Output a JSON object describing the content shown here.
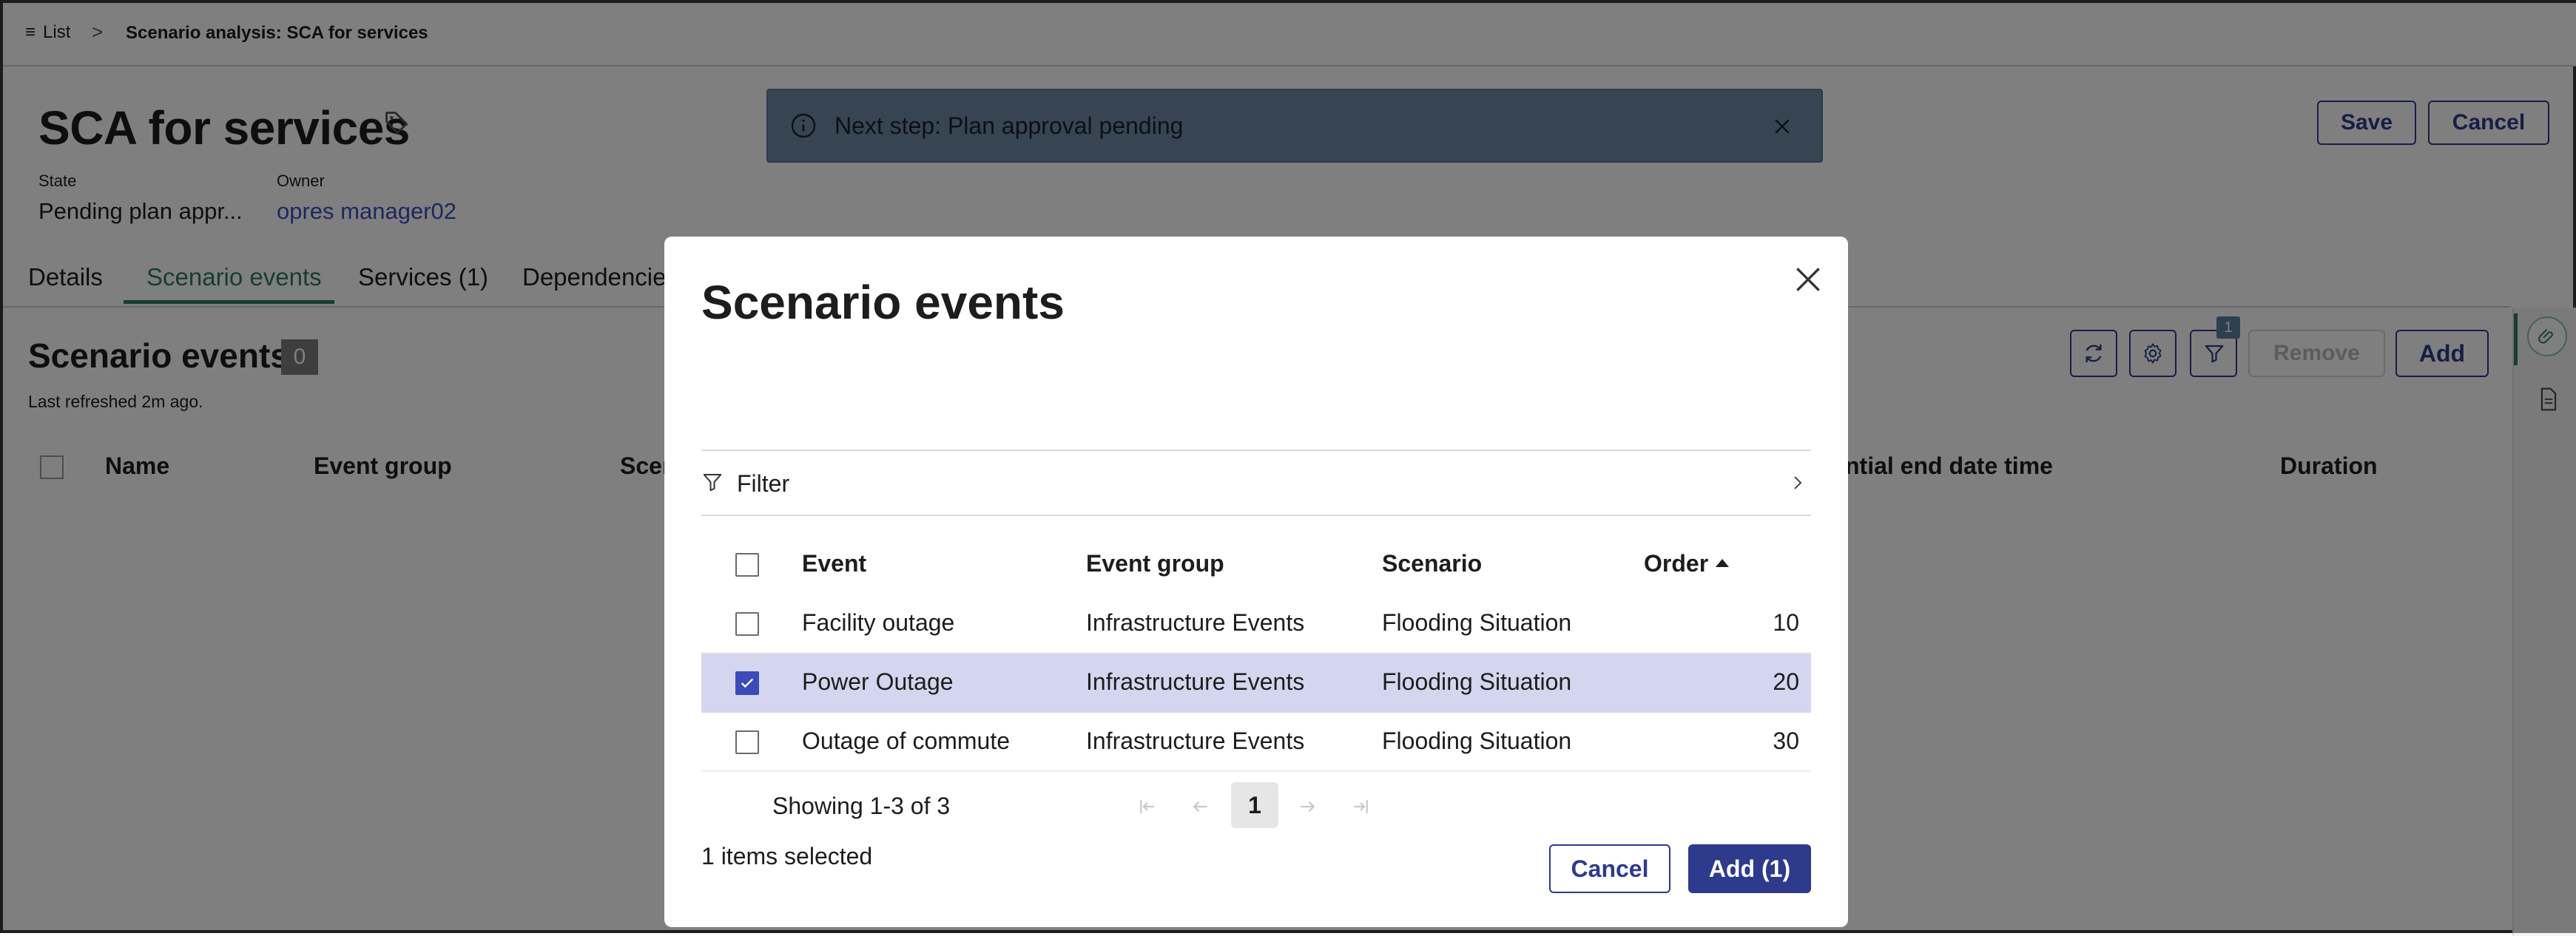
{
  "breadcrumb": {
    "list_icon": "list-icon",
    "list_label": "List",
    "separator": ">",
    "current": "Scenario analysis: SCA for services"
  },
  "header": {
    "title": "SCA for services",
    "tag_icon": "tag-icon",
    "state_label": "State",
    "state_value": "Pending plan appr...",
    "owner_label": "Owner",
    "owner_value": "opres manager02",
    "save_label": "Save",
    "cancel_label": "Cancel"
  },
  "toast": {
    "icon": "info-icon",
    "message": "Next step: Plan approval pending"
  },
  "tabs": [
    {
      "label": "Details"
    },
    {
      "label": "Scenario events",
      "active": true
    },
    {
      "label": "Services (1)"
    },
    {
      "label": "Dependencies"
    }
  ],
  "list": {
    "title": "Scenario events",
    "count": "0",
    "last_refreshed": "Last refreshed 2m ago.",
    "filter_badge": "1",
    "remove_label": "Remove",
    "add_label": "Add",
    "columns": [
      "Name",
      "Event group",
      "Scen",
      "ntial end date time",
      "Duration"
    ]
  },
  "modal": {
    "title": "Scenario events",
    "filter_label": "Filter",
    "columns": {
      "event": "Event",
      "event_group": "Event group",
      "scenario": "Scenario",
      "order": "Order"
    },
    "rows": [
      {
        "event": "Facility outage",
        "event_group": "Infrastructure Events",
        "scenario": "Flooding Situation",
        "order": "10",
        "checked": false
      },
      {
        "event": "Power Outage",
        "event_group": "Infrastructure Events",
        "scenario": "Flooding Situation",
        "order": "20",
        "checked": true
      },
      {
        "event": "Outage of commute",
        "event_group": "Infrastructure Events",
        "scenario": "Flooding Situation",
        "order": "30",
        "checked": false
      }
    ],
    "showing": "Showing 1-3 of 3",
    "page": "1",
    "selected_count": "1 items selected",
    "cancel_label": "Cancel",
    "add_label": "Add (1)"
  },
  "colors": {
    "primary": "#2e3a8c",
    "accent_green": "#2f7a62",
    "selected_row": "#d4d6ef",
    "toast_bg": "#6d8aa3"
  }
}
